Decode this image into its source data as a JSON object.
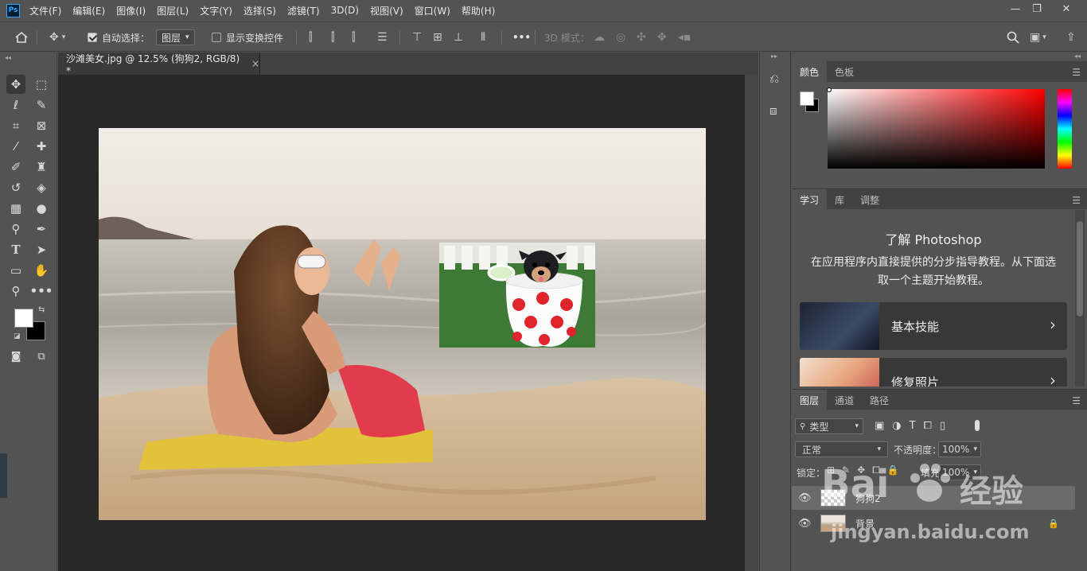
{
  "app": {
    "logo": "Ps"
  },
  "menu": [
    "文件(F)",
    "编辑(E)",
    "图像(I)",
    "图层(L)",
    "文字(Y)",
    "选择(S)",
    "滤镜(T)",
    "3D(D)",
    "视图(V)",
    "窗口(W)",
    "帮助(H)"
  ],
  "window_controls": {
    "minimize": "—",
    "restore": "❐",
    "close": "✕"
  },
  "options": {
    "auto_select_label": "自动选择：",
    "auto_select_value": "图层",
    "show_transform_label": "显示变换控件",
    "more": "•••",
    "mode3d_label": "3D 模式："
  },
  "document_tab": {
    "title": "沙滩美女.jpg @ 12.5% (狗狗2, RGB/8) *",
    "close": "×"
  },
  "color_panel": {
    "tabs": [
      "颜色",
      "色板"
    ],
    "foreground": "#ffffff",
    "background": "#000000",
    "hue_color": "#ff0000"
  },
  "learn_panel": {
    "tabs": [
      "学习",
      "库",
      "调整"
    ],
    "heading": "了解 Photoshop",
    "description": "在应用程序内直接提供的分步指导教程。从下面选取一个主题开始教程。",
    "cards": [
      "基本技能",
      "修复照片"
    ]
  },
  "layers_panel": {
    "tabs": [
      "图层",
      "通道",
      "路径"
    ],
    "filter_label": "类型",
    "blend_mode": "正常",
    "opacity_label": "不透明度：",
    "opacity_value": "100%",
    "lock_label": "锁定：",
    "fill_label": "填充：",
    "fill_value": "100%",
    "layers": [
      {
        "name": "狗狗2",
        "visible": true,
        "selected": true
      },
      {
        "name": "背景",
        "visible": true,
        "locked": true
      }
    ]
  },
  "watermark": {
    "brand": "Bai",
    "brand_suffix": "经验",
    "url": "jingyan.baidu.com"
  }
}
